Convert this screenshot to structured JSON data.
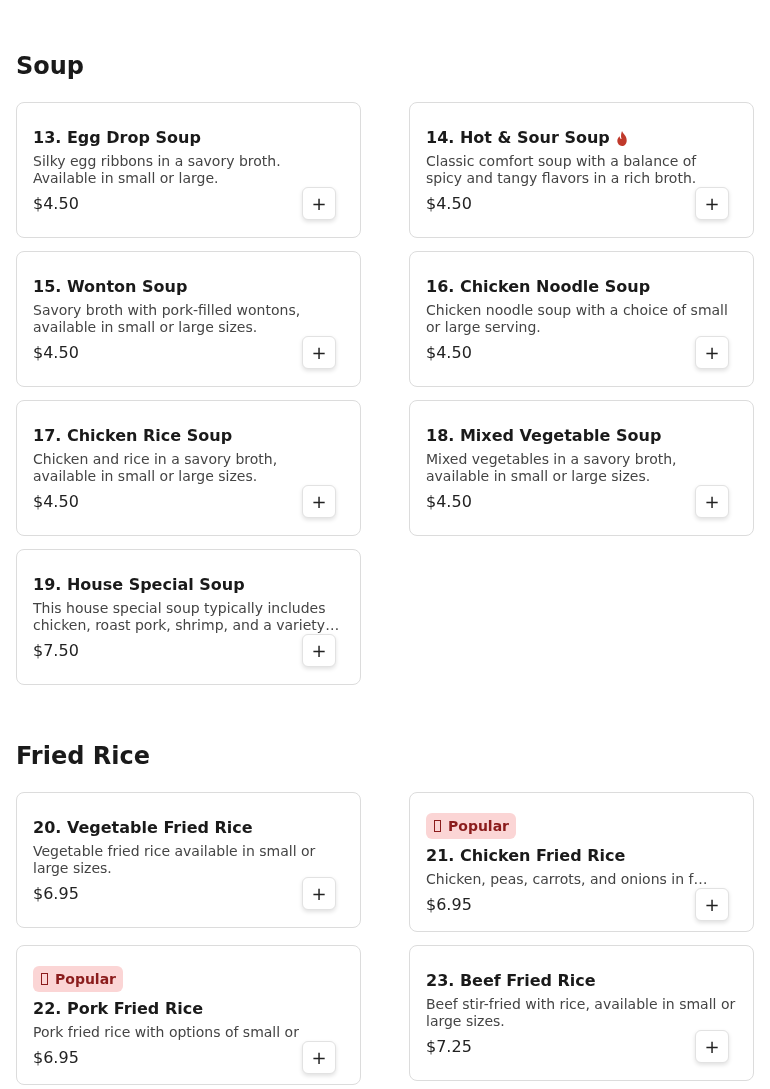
{
  "sections": [
    {
      "title": "Soup",
      "items": [
        {
          "name": "13. Egg Drop Soup",
          "spicy": false,
          "description": "Silky egg ribbons in a savory broth. Available in small or large.",
          "price": "$4.50",
          "add": "+"
        },
        {
          "name": "14. Hot & Sour Soup",
          "spicy": true,
          "description": "Classic comfort soup with a balance of spicy and tangy flavors in a rich broth.",
          "price": "$4.50",
          "add": "+"
        },
        {
          "name": "15. Wonton Soup",
          "spicy": false,
          "description": "Savory broth with pork-filled wontons, available in small or large sizes.",
          "price": "$4.50",
          "add": "+"
        },
        {
          "name": "16. Chicken Noodle Soup",
          "spicy": false,
          "description": "Chicken noodle soup with a choice of small or large serving.",
          "price": "$4.50",
          "add": "+"
        },
        {
          "name": "17. Chicken Rice Soup",
          "spicy": false,
          "description": "Chicken and rice in a savory broth, available in small or large sizes.",
          "price": "$4.50",
          "add": "+"
        },
        {
          "name": "18. Mixed Vegetable Soup",
          "spicy": false,
          "description": "Mixed vegetables in a savory broth, available in small or large sizes.",
          "price": "$4.50",
          "add": "+"
        },
        {
          "name": "19. House Special Soup",
          "spicy": false,
          "description": "This house special soup typically includes chicken, roast pork, shrimp, and a variety…",
          "price": "$7.50",
          "add": "+"
        }
      ]
    },
    {
      "title": "Fried Rice",
      "items": [
        {
          "name": "20. Vegetable Fried Rice",
          "spicy": false,
          "description": "Vegetable fried rice available in small or large sizes.",
          "price": "$6.95",
          "add": "+"
        },
        {
          "badge": "Popular",
          "name": "21. Chicken Fried Rice",
          "spicy": false,
          "description": "Chicken, peas, carrots, and onions in f…",
          "price": "$6.95",
          "add": "+"
        },
        {
          "badge": "Popular",
          "name": "22. Pork Fried Rice",
          "spicy": false,
          "description": "Pork fried rice with options of small or",
          "price": "$6.95",
          "add": "+"
        },
        {
          "name": "23. Beef Fried Rice",
          "spicy": false,
          "description": "Beef stir-fried with rice, available in small or large sizes.",
          "price": "$7.25",
          "add": "+"
        }
      ]
    }
  ]
}
